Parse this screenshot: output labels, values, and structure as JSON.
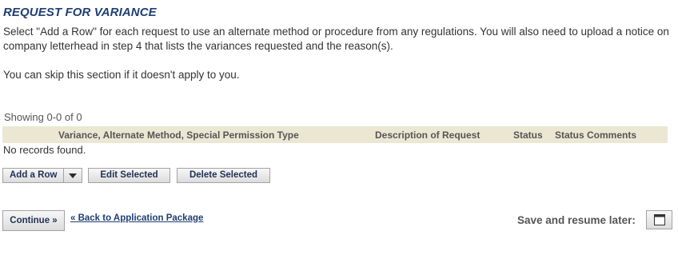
{
  "section": {
    "title": "REQUEST FOR VARIANCE",
    "intro": "Select \"Add a Row\" for each request to use an alternate method or procedure from any regulations. You will also need to upload a notice on company letterhead in step 4 that lists the variances requested and the reason(s).",
    "skip_note": "You can skip this section if it doesn't apply to you."
  },
  "grid": {
    "showing": "Showing 0-0 of 0",
    "columns": {
      "type": "Variance, Alternate Method, Special Permission Type",
      "description": "Description of Request",
      "status": "Status",
      "comments": "Status Comments"
    },
    "empty_message": "No records found."
  },
  "toolbar": {
    "add_row_label": "Add a Row",
    "edit_label": "Edit Selected",
    "delete_label": "Delete Selected"
  },
  "footer": {
    "continue_label": "Continue »",
    "back_link": "« Back to Application Package",
    "save_resume_label": "Save and resume later:"
  },
  "icons": {
    "dropdown": "chevron-down-icon",
    "save": "window-icon"
  }
}
